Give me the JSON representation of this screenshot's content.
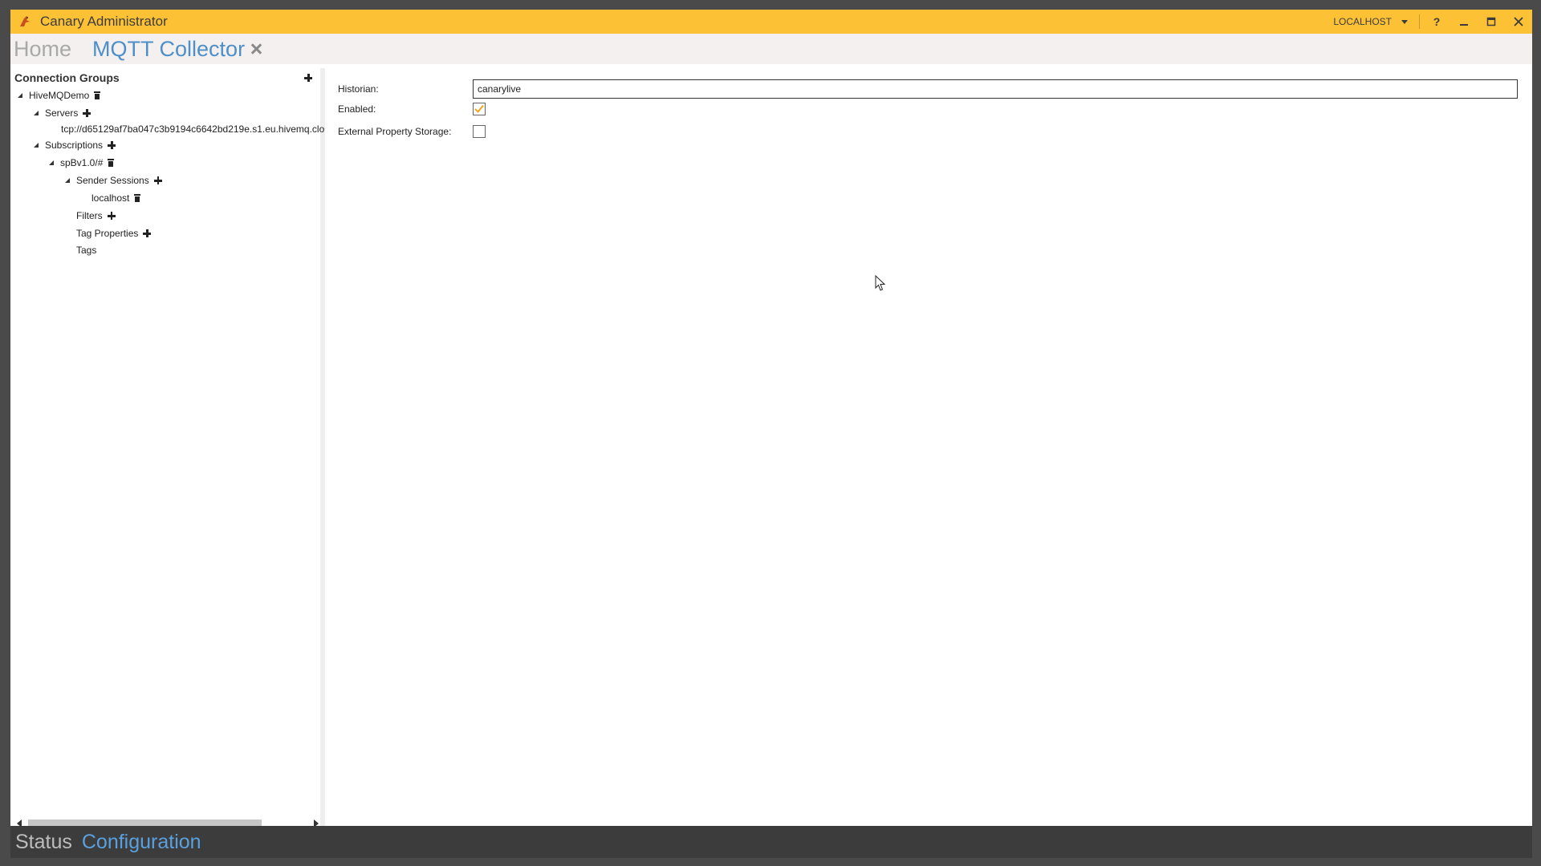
{
  "window": {
    "title": "Canary Administrator",
    "server": "LOCALHOST",
    "help_label": "?",
    "accent_color": "#fdc136"
  },
  "tabs": [
    {
      "label": "Home",
      "active": false
    },
    {
      "label": "MQTT Collector",
      "active": true
    }
  ],
  "sidebar": {
    "title": "Connection Groups",
    "tree": {
      "group": "HiveMQDemo",
      "servers": "Servers",
      "server_url": "tcp://d65129af7ba047c3b9194c6642bd219e.s1.eu.hivemq.clo",
      "subscriptions": "Subscriptions",
      "subscription": "spBv1.0/#",
      "sender_sessions": "Sender Sessions",
      "session": "localhost",
      "filters": "Filters",
      "tag_properties": "Tag Properties",
      "tags": "Tags"
    }
  },
  "form": {
    "historian_label": "Historian:",
    "historian_value": "canarylive",
    "enabled_label": "Enabled:",
    "enabled_checked": true,
    "external_storage_label": "External Property Storage:",
    "external_storage_checked": false
  },
  "bottom_tabs": [
    {
      "label": "Status",
      "active": false
    },
    {
      "label": "Configuration",
      "active": true
    }
  ]
}
